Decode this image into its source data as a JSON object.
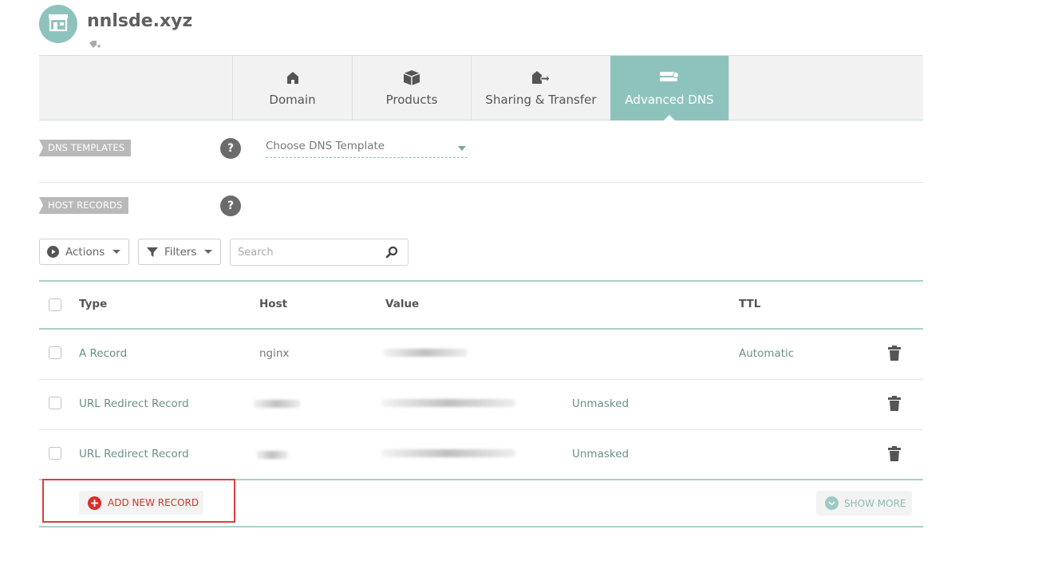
{
  "domain": {
    "name": "nnlsde.xyz"
  },
  "tabs": [
    {
      "label": "Domain",
      "icon": "home-icon"
    },
    {
      "label": "Products",
      "icon": "box-icon"
    },
    {
      "label": "Sharing & Transfer",
      "icon": "share-transfer-icon"
    },
    {
      "label": "Advanced DNS",
      "icon": "server-icon",
      "active": true
    }
  ],
  "dns_templates": {
    "label": "DNS TEMPLATES",
    "select_value": "Choose DNS Template"
  },
  "host_records": {
    "label": "HOST RECORDS",
    "actions_label": "Actions",
    "filters_label": "Filters",
    "search_placeholder": "Search",
    "columns": {
      "type": "Type",
      "host": "Host",
      "value": "Value",
      "ttl": "TTL"
    },
    "rows": [
      {
        "type": "A Record",
        "host": "nginx",
        "value": "",
        "extra": "",
        "ttl": "Automatic"
      },
      {
        "type": "URL Redirect Record",
        "host": "",
        "value": "",
        "extra": "Unmasked",
        "ttl": ""
      },
      {
        "type": "URL Redirect Record",
        "host": "",
        "value": "",
        "extra": "Unmasked",
        "ttl": ""
      }
    ],
    "add_label": "ADD NEW RECORD",
    "show_more_label": "SHOW MORE"
  },
  "colors": {
    "accent": "#8ec3bd",
    "danger": "#d7302b",
    "highlight": "#d94040"
  }
}
